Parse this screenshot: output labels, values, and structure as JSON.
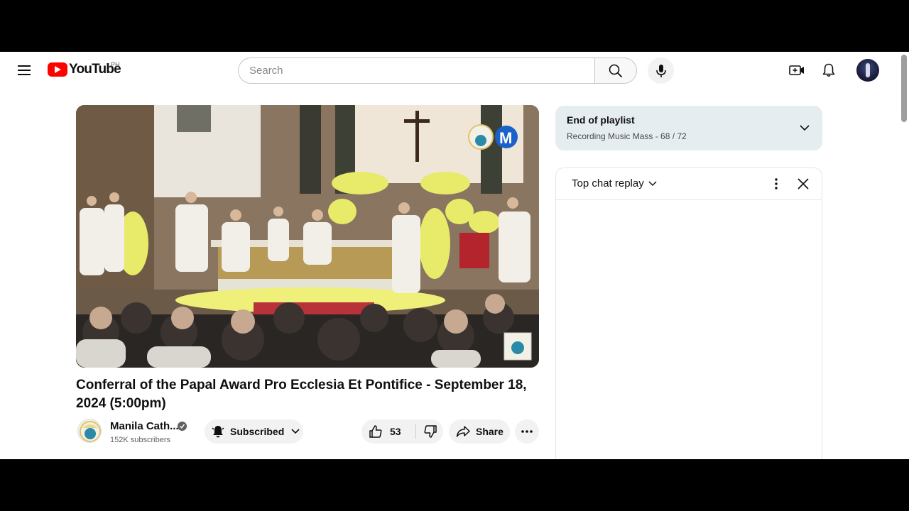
{
  "header": {
    "logo_text": "YouTube",
    "country_code": "PH",
    "search_placeholder": "Search",
    "icons": [
      "menu-icon",
      "search-icon",
      "microphone-icon",
      "create-video-icon",
      "bell-icon",
      "avatar"
    ]
  },
  "video": {
    "title": "Conferral of the Papal Award Pro Ecclesia Et Pontifice - September 18, 2024 (5:00pm)",
    "channel_name": "Manila Cath...",
    "subscribers": "152K subscribers",
    "subscribe_label": "Subscribed",
    "like_count": "53",
    "share_label": "Share"
  },
  "playlist": {
    "title": "End of playlist",
    "subtitle": "Recording Music Mass - 68 / 72"
  },
  "chat": {
    "title": "Top chat replay"
  },
  "colors": {
    "brand_red": "#ff0000",
    "playlist_bg": "#e6edf1",
    "button_bg": "#f2f2f2",
    "text_primary": "#0f0f0f",
    "text_secondary": "#606060"
  }
}
